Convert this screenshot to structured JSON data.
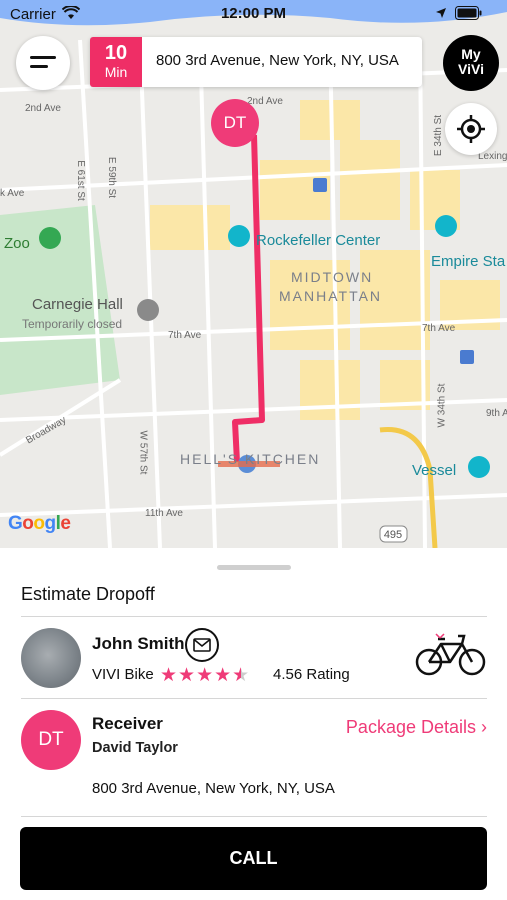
{
  "status_bar": {
    "carrier": "Carrier",
    "time": "12:00 PM"
  },
  "header": {
    "eta_value": "10",
    "eta_unit": "Min",
    "address": "800 3rd Avenue, New York, NY, USA",
    "profile_button_line1": "My",
    "profile_button_line2": "ViVi"
  },
  "map": {
    "route_color": "#ef2e66",
    "destination_pin_initials": "DT",
    "attribution": "Google",
    "labels": {
      "rockefeller": "Rockefeller Center",
      "midtown": "MIDTOWN",
      "manhattan": "MANHATTAN",
      "empire": "Empire Sta",
      "carnegie": "Carnegie Hall",
      "carnegie_sub": "Temporarily closed",
      "zoo": "Zoo",
      "hells_kitchen": "HELL'S KITCHEN",
      "vessel": "Vessel",
      "seventh_ave_left": "7th Ave",
      "seventh_ave_right": "7th Ave",
      "ninth_ave": "9th Av",
      "eleventh_ave": "11th Ave",
      "broadway": "Broadway",
      "second_ave": "2nd Ave",
      "second_ave_top": "2nd Ave",
      "lexing": "Lexing",
      "e61": "E 61st St",
      "e59": "E 59th St",
      "w57": "W 57th St",
      "e34": "E 34th St",
      "w34": "W 34th St",
      "ave_k": "k Ave",
      "route_495": "495"
    }
  },
  "sheet": {
    "title": "Estimate Dropoff",
    "courier": {
      "name": "John Smith",
      "vehicle": "VIVI Bike",
      "stars": "★★★★",
      "rating_value": 4.56,
      "rating_text": "4.56 Rating"
    },
    "receiver": {
      "initials": "DT",
      "label": "Receiver",
      "name": "David Taylor",
      "address": "800 3rd Avenue, New York, NY, USA",
      "package_link": "Package Details ›"
    },
    "call_label": "CALL"
  },
  "colors": {
    "accent": "#ef3b78",
    "route": "#ef2e66",
    "button": "#000000"
  },
  "icons": [
    "menu-icon",
    "wifi-icon",
    "location-arrow-icon",
    "battery-icon",
    "locate-icon",
    "mail-icon",
    "bicycle-icon",
    "star-icon",
    "half-star-icon",
    "chevron-right-icon"
  ]
}
